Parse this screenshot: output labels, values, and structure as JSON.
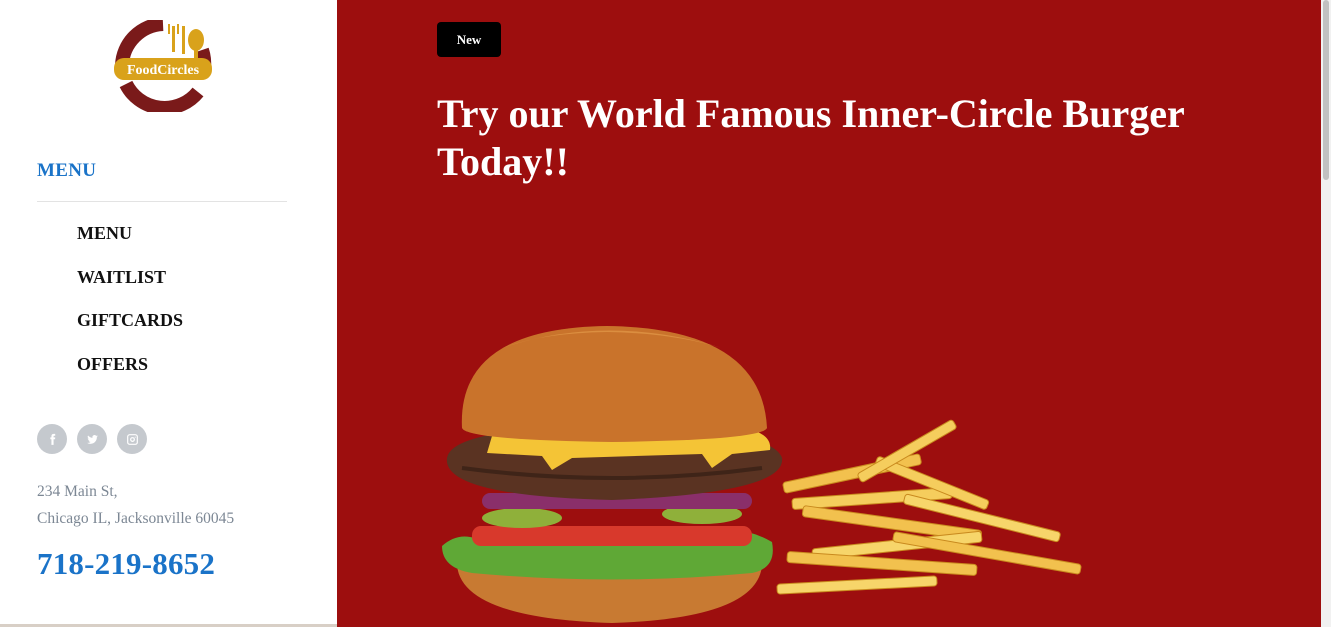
{
  "brand": {
    "name": "FoodCircles"
  },
  "sidebar": {
    "menu_heading": "MENU",
    "nav": [
      {
        "label": "MENU"
      },
      {
        "label": "WAITLIST"
      },
      {
        "label": "GIFTCARDS"
      },
      {
        "label": "OFFERS"
      }
    ],
    "socials": [
      {
        "icon": "facebook-icon"
      },
      {
        "icon": "twitter-icon"
      },
      {
        "icon": "instagram-icon"
      }
    ],
    "address_line1": "234 Main St,",
    "address_line2": "Chicago IL, Jacksonville 60045",
    "phone": "718-219-8652"
  },
  "hero": {
    "badge": "New",
    "headline": "Try our World Famous Inner-Circle Burger Today!!",
    "image": "burger-and-fries"
  },
  "colors": {
    "accent": "#1a73c8",
    "hero_background": "#9d0e0e",
    "logo_maroon": "#7a1a1a",
    "logo_gold": "#d9a21b"
  }
}
